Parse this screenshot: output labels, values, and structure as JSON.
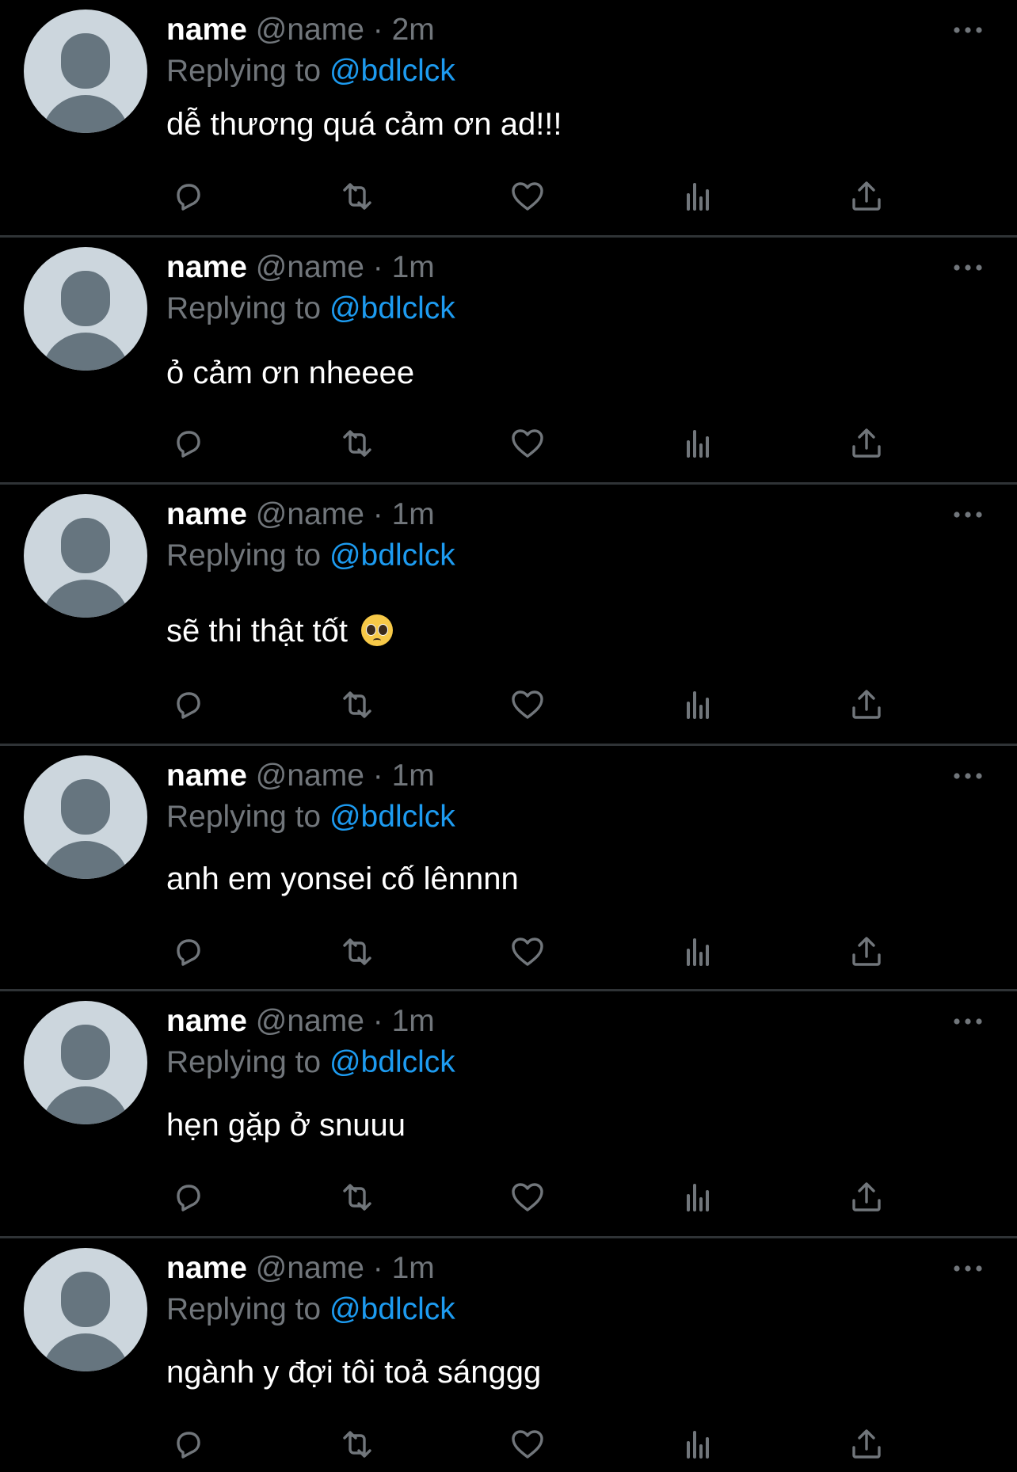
{
  "tweets": [
    {
      "display_name": "name",
      "handle": "@name",
      "time": "2m",
      "replying_prefix": "Replying to",
      "replying_handle": "@bdlclck",
      "text": "dễ thương quá cảm ơn ad!!!",
      "emoji": ""
    },
    {
      "display_name": "name",
      "handle": "@name",
      "time": "1m",
      "replying_prefix": "Replying to",
      "replying_handle": "@bdlclck",
      "text": "ỏ cảm ơn nheeee",
      "emoji": ""
    },
    {
      "display_name": "name",
      "handle": "@name",
      "time": "1m",
      "replying_prefix": "Replying to",
      "replying_handle": "@bdlclck",
      "text": "sẽ thi thật tốt",
      "emoji": "pleading-face-emoji"
    },
    {
      "display_name": "name",
      "handle": "@name",
      "time": "1m",
      "replying_prefix": "Replying to",
      "replying_handle": "@bdlclck",
      "text": "anh em yonsei cố lênnnn",
      "emoji": ""
    },
    {
      "display_name": "name",
      "handle": "@name",
      "time": "1m",
      "replying_prefix": "Replying to",
      "replying_handle": "@bdlclck",
      "text": "hẹn gặp ở snuuu",
      "emoji": ""
    },
    {
      "display_name": "name",
      "handle": "@name",
      "time": "1m",
      "replying_prefix": "Replying to",
      "replying_handle": "@bdlclck",
      "text": "ngành y đợi tôi toả sánggg",
      "emoji": ""
    }
  ],
  "actions": [
    "reply-icon",
    "retweet-icon",
    "like-icon",
    "views-icon",
    "share-icon"
  ],
  "colors": {
    "background": "#000000",
    "text_primary": "#ffffff",
    "text_secondary": "#71767b",
    "accent": "#1d9bf0",
    "divider": "#2f3336",
    "icon": "#71767b",
    "avatar_bg": "#ccd6dd",
    "avatar_fg": "#66757f"
  }
}
